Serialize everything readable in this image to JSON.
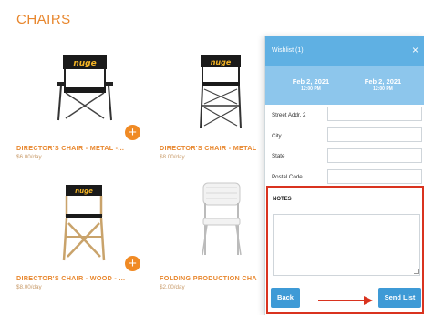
{
  "category": {
    "title": "CHAIRS"
  },
  "products": [
    {
      "name": "DIRECTOR'S CHAIR - METAL -...",
      "price": "$6.00/day",
      "image_logo": "nuge"
    },
    {
      "name": "DIRECTOR'S CHAIR - METAL",
      "price": "$8.00/day",
      "image_logo": "nuge"
    },
    {
      "name": "DIRECTOR'S CHAIR - WOOD - ...",
      "price": "$8.00/day",
      "image_logo": "nuge"
    },
    {
      "name": "FOLDING PRODUCTION CHA",
      "price": "$2.00/day"
    }
  ],
  "add_icon": "+",
  "wishlist": {
    "title": "Wishlist (1)",
    "close_icon": "×",
    "start": {
      "date": "Feb 2, 2021",
      "time": "12:00 PM"
    },
    "end": {
      "date": "Feb 2, 2021",
      "time": "12:00 PM"
    },
    "fields": [
      {
        "label": "Street Addr. 2",
        "value": ""
      },
      {
        "label": "City",
        "value": ""
      },
      {
        "label": "State",
        "value": ""
      },
      {
        "label": "Postal Code",
        "value": ""
      }
    ],
    "notes_label": "NOTES",
    "notes_value": "",
    "back_label": "Back",
    "send_label": "Send List"
  },
  "colors": {
    "accent": "#e8872e",
    "header": "#5fb0e3",
    "dates": "#8dc6ec",
    "button": "#3e9ad6",
    "highlight": "#d9331f"
  }
}
